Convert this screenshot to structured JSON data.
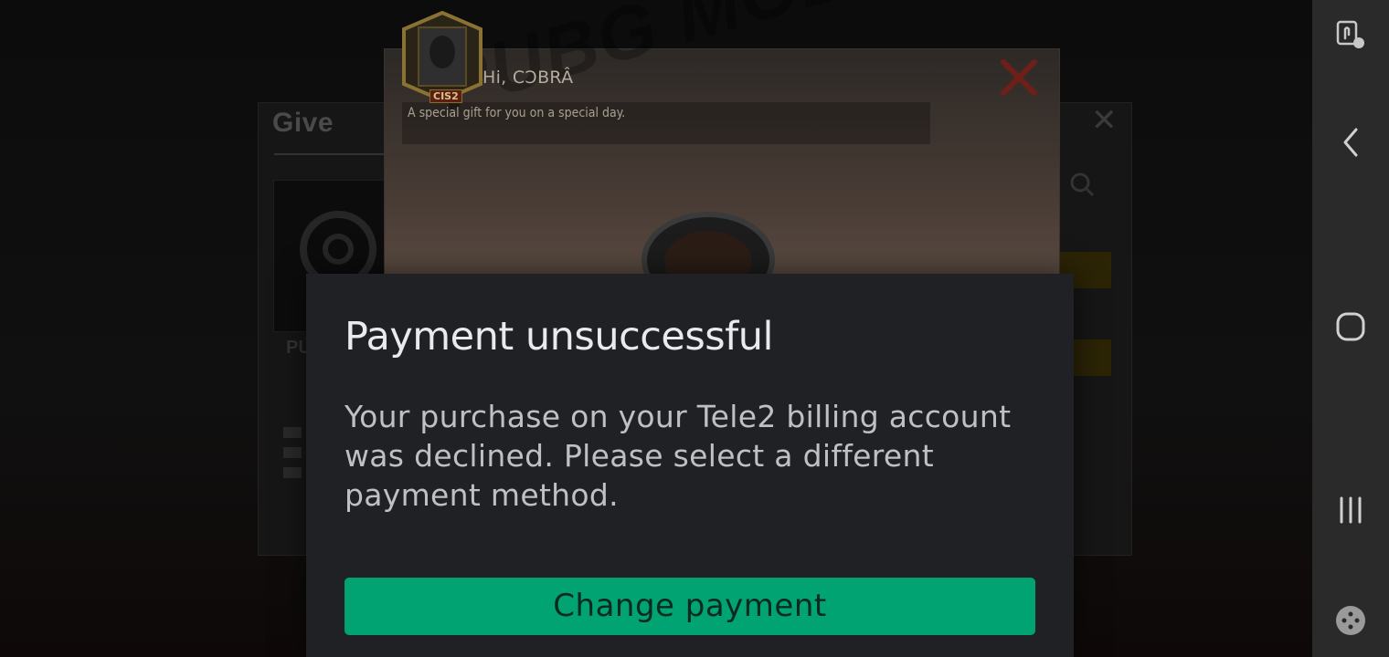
{
  "background_game": {
    "panel_title": "Give",
    "item_label": "PU",
    "gift_card": {
      "greeting": "Hi, CƆBRÂ",
      "message": "A special gift for you on a special day.",
      "watermark": "PUBG MOBILE",
      "avatar_badge": "CIS2"
    }
  },
  "dialog": {
    "title": "Payment unsuccessful",
    "body": "Your purchase on your Tele2 billing account was declined. Please select a different payment method.",
    "primary_button": "Change payment",
    "button_color": "#01a373",
    "background_color": "#202124"
  },
  "nav_bar": {
    "items": [
      {
        "icon": "touch-lock-icon"
      },
      {
        "icon": "back-chevron-icon"
      },
      {
        "icon": "home-icon"
      },
      {
        "icon": "recents-icon"
      },
      {
        "icon": "game-tools-icon"
      }
    ]
  }
}
